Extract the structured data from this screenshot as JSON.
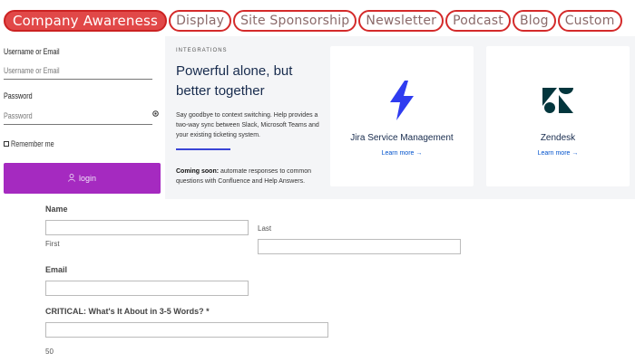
{
  "tabs": [
    {
      "label": "Company Awareness",
      "active": true
    },
    {
      "label": "Display",
      "active": false
    },
    {
      "label": "Site Sponsorship",
      "active": false
    },
    {
      "label": "Newsletter",
      "active": false
    },
    {
      "label": "Podcast",
      "active": false
    },
    {
      "label": "Blog",
      "active": false
    },
    {
      "label": "Custom",
      "active": false
    }
  ],
  "login": {
    "username_label": "Username or Email",
    "username_placeholder": "Username or Email",
    "password_label": "Password",
    "password_placeholder": "Password",
    "remember_label": "Remember me",
    "button_label": "login",
    "button_icon": "user-icon",
    "eye_icon": "eye-icon"
  },
  "integrations": {
    "kicker": "INTEGRATIONS",
    "headline": "Powerful alone, but better together",
    "description": "Say goodbye to context switching. Help provides a two-way sync between Slack, Microsoft Teams and your existing ticketing system.",
    "soon_bold": "Coming soon:",
    "soon_text": " automate responses to common questions with Confluence and Help Answers.",
    "cards": [
      {
        "name": "Jira Service Management",
        "link": "Learn more →",
        "logo_color": "#2f3cf0",
        "icon": "lightning-icon"
      },
      {
        "name": "Zendesk",
        "link": "Learn more →",
        "logo_color": "#03363d",
        "icon": "zendesk-icon"
      }
    ]
  },
  "form": {
    "name_label": "Name",
    "first_label": "First",
    "last_label": "Last",
    "email_label": "Email",
    "critical_label": "CRITICAL: What's It About in 3-5 Words? *",
    "counter": "50"
  },
  "colors": {
    "tab_border": "#d42a2a",
    "tab_active_bg": "#e14848",
    "login_button": "#a52ac0",
    "integrations_bg": "#f4f5f7",
    "accent_bar": "#3a44d6"
  }
}
